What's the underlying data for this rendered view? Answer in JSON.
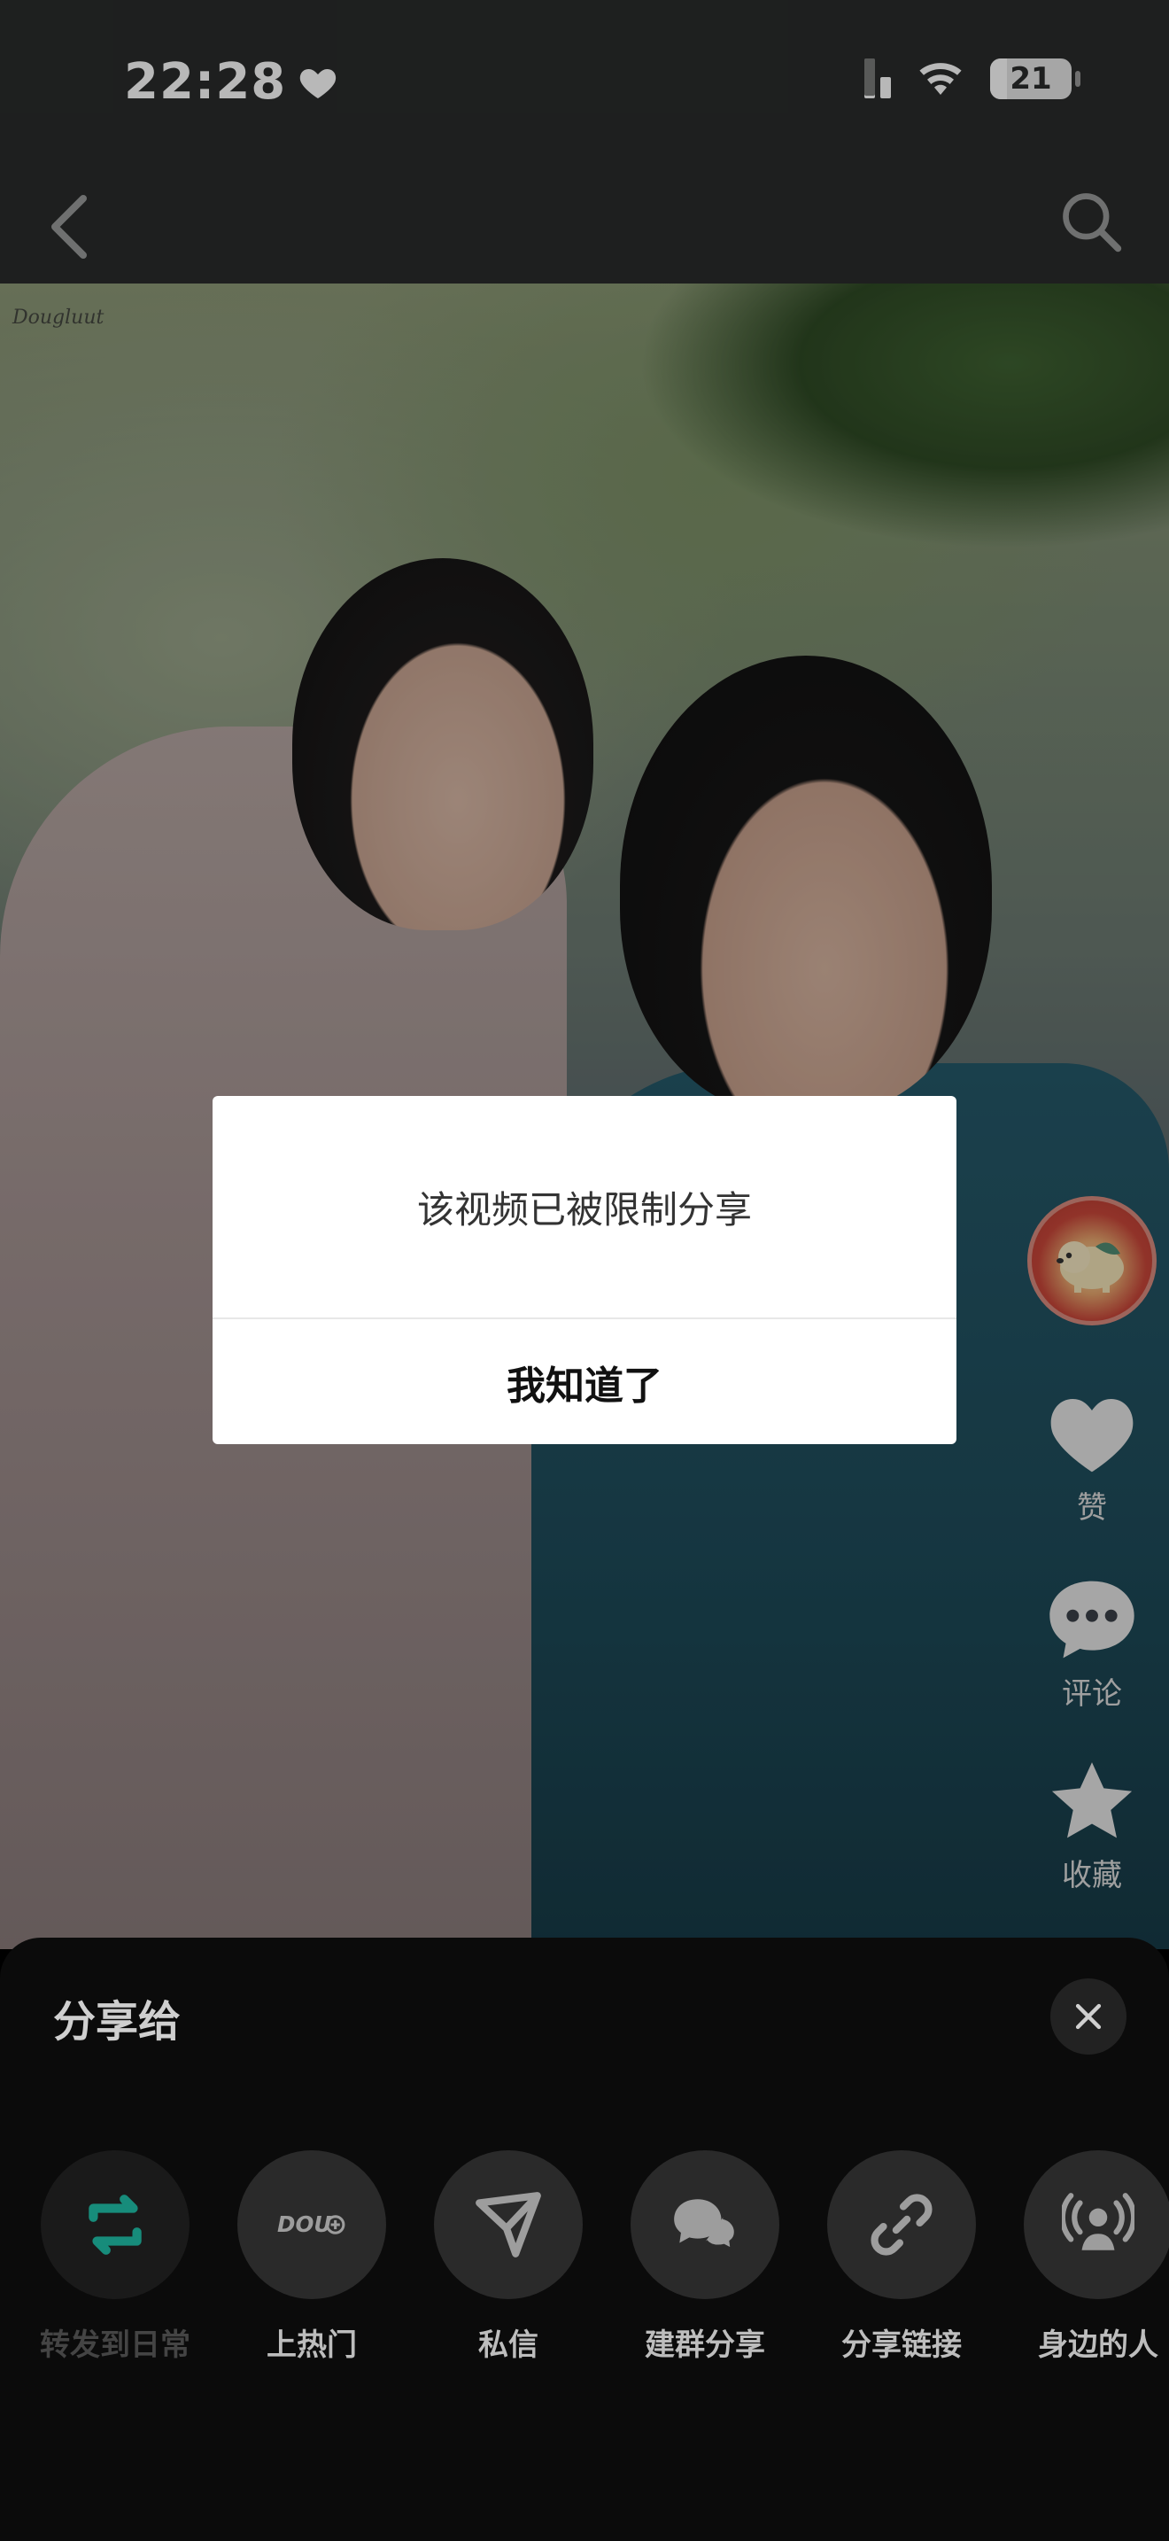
{
  "status_bar": {
    "time": "22:28",
    "battery": "21",
    "battery_level": 0.21,
    "signal_bars_active": 2,
    "signal_bars_total": 4
  },
  "header": {
    "back_icon": "chevron-left-icon",
    "search_icon": "search-icon"
  },
  "video": {
    "watermark": "Dougluut"
  },
  "actions": {
    "like_label": "赞",
    "comment_label": "评论",
    "favorite_label": "收藏"
  },
  "modal": {
    "message": "该视频已被限制分享",
    "confirm_label": "我知道了"
  },
  "share_sheet": {
    "title": "分享给",
    "items": [
      {
        "label": "转发到日常",
        "icon": "repost-icon",
        "disabled": true
      },
      {
        "label": "上热门",
        "icon": "dou-plus-icon",
        "disabled": false
      },
      {
        "label": "私信",
        "icon": "send-icon",
        "disabled": false
      },
      {
        "label": "建群分享",
        "icon": "group-chat-icon",
        "disabled": false
      },
      {
        "label": "分享链接",
        "icon": "link-icon",
        "disabled": false
      },
      {
        "label": "身边的人",
        "icon": "nearby-people-icon",
        "disabled": false
      }
    ]
  },
  "colors": {
    "accent_teal": "#1fb39c",
    "sheet_bg": "#0b0b0b",
    "modal_bg": "#ffffff"
  }
}
